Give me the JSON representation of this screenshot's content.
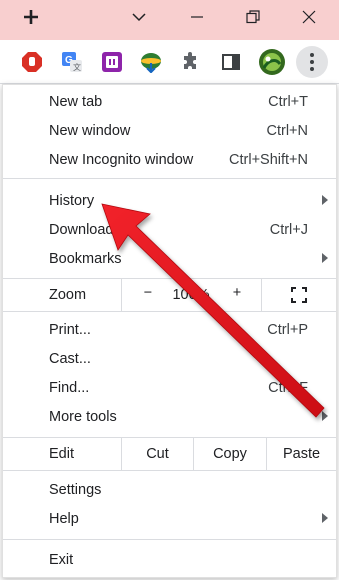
{
  "titlebar": {
    "new_tab_icon": "plus-icon",
    "tab_search_icon": "chevron-down-icon",
    "minimize_icon": "minimize-icon",
    "maximize_icon": "restore-icon",
    "close_icon": "close-icon",
    "background": "#f8cfcf"
  },
  "toolbar": {
    "extensions": [
      {
        "name": "adblock-extension-icon",
        "color": "#d93025"
      },
      {
        "name": "translate-extension-icon",
        "color": "#4285f4"
      },
      {
        "name": "screencast-extension-icon",
        "color": "#8e24aa"
      },
      {
        "name": "idm-extension-icon",
        "color": "#2e7d32"
      },
      {
        "name": "puzzle-extensions-icon",
        "color": "#5f6368"
      },
      {
        "name": "side-panel-icon",
        "color": "#5f6368"
      }
    ],
    "menu_icon": "more-vertical-icon"
  },
  "menu": {
    "new_tab": {
      "label": "New tab",
      "shortcut": "Ctrl+T"
    },
    "new_window": {
      "label": "New window",
      "shortcut": "Ctrl+N"
    },
    "new_incognito": {
      "label": "New Incognito window",
      "shortcut": "Ctrl+Shift+N"
    },
    "history": {
      "label": "History"
    },
    "downloads": {
      "label": "Downloads",
      "shortcut": "Ctrl+J"
    },
    "bookmarks": {
      "label": "Bookmarks"
    },
    "zoom": {
      "label": "Zoom",
      "minus": "−",
      "value": "100%",
      "plus": "+",
      "fullscreen_icon": "fullscreen-icon"
    },
    "print": {
      "label": "Print...",
      "shortcut": "Ctrl+P"
    },
    "cast": {
      "label": "Cast..."
    },
    "find": {
      "label": "Find...",
      "shortcut": "Ctrl+F"
    },
    "more_tools": {
      "label": "More tools"
    },
    "edit": {
      "label": "Edit",
      "cut": "Cut",
      "copy": "Copy",
      "paste": "Paste"
    },
    "settings": {
      "label": "Settings"
    },
    "help": {
      "label": "Help"
    },
    "exit": {
      "label": "Exit"
    }
  },
  "annotation": {
    "color": "#e8141c",
    "icon": "red-arrow-annotation"
  }
}
